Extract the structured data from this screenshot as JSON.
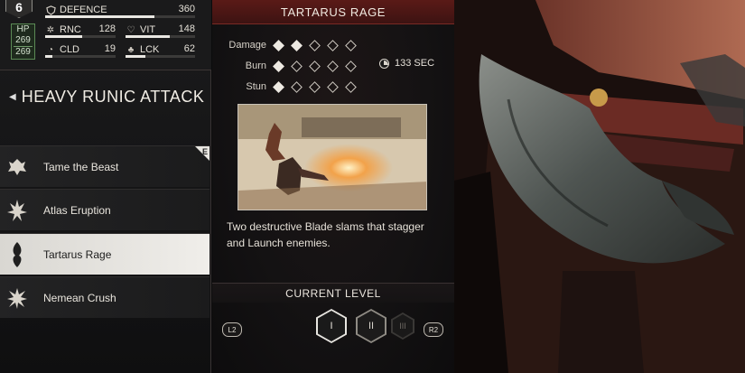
{
  "player": {
    "level": "6",
    "hp_label": "HP",
    "hp_current": "269",
    "hp_max": "269"
  },
  "stats": [
    {
      "key": "defence",
      "label": "DEFENCE",
      "value": "360",
      "icon": "shield-icon",
      "fill": 0.73
    },
    {
      "key": "rnc",
      "label": "RNC",
      "value": "128",
      "icon": "runic-icon",
      "fill": 0.52
    },
    {
      "key": "vit",
      "label": "VIT",
      "value": "148",
      "icon": "heart-icon",
      "fill": 0.64
    },
    {
      "key": "cld",
      "label": "CLD",
      "value": "19",
      "icon": "cooldown-icon",
      "fill": 0.1
    },
    {
      "key": "lck",
      "label": "LCK",
      "value": "62",
      "icon": "clover-icon",
      "fill": 0.28
    }
  ],
  "section_title": "HEAVY RUNIC ATTACK",
  "abilities": [
    {
      "name": "Tame the Beast",
      "icon": "beast-icon",
      "equipped_tag": "E",
      "selected": false
    },
    {
      "name": "Atlas Eruption",
      "icon": "eruption-icon",
      "selected": false
    },
    {
      "name": "Tartarus Rage",
      "icon": "rage-icon",
      "selected": true
    },
    {
      "name": "Nemean Crush",
      "icon": "crush-icon",
      "selected": false
    }
  ],
  "detail": {
    "title": "TARTARUS RAGE",
    "attributes": [
      {
        "label": "Damage",
        "rating": 2,
        "max": 5
      },
      {
        "label": "Burn",
        "rating": 1,
        "max": 5
      },
      {
        "label": "Stun",
        "rating": 1,
        "max": 5
      }
    ],
    "cooldown": "133 SEC",
    "description": "Two destructive Blade slams that stagger and Launch enemies.",
    "current_level_label": "CURRENT LEVEL",
    "levels": [
      "I",
      "II",
      "III"
    ],
    "current_level_index": 0,
    "prev_button": "L2",
    "next_button": "R2"
  },
  "colors": {
    "accent_red": "#5a1a17",
    "selected_row": "#e8e6e1",
    "hp_green": "#5b8a55"
  }
}
